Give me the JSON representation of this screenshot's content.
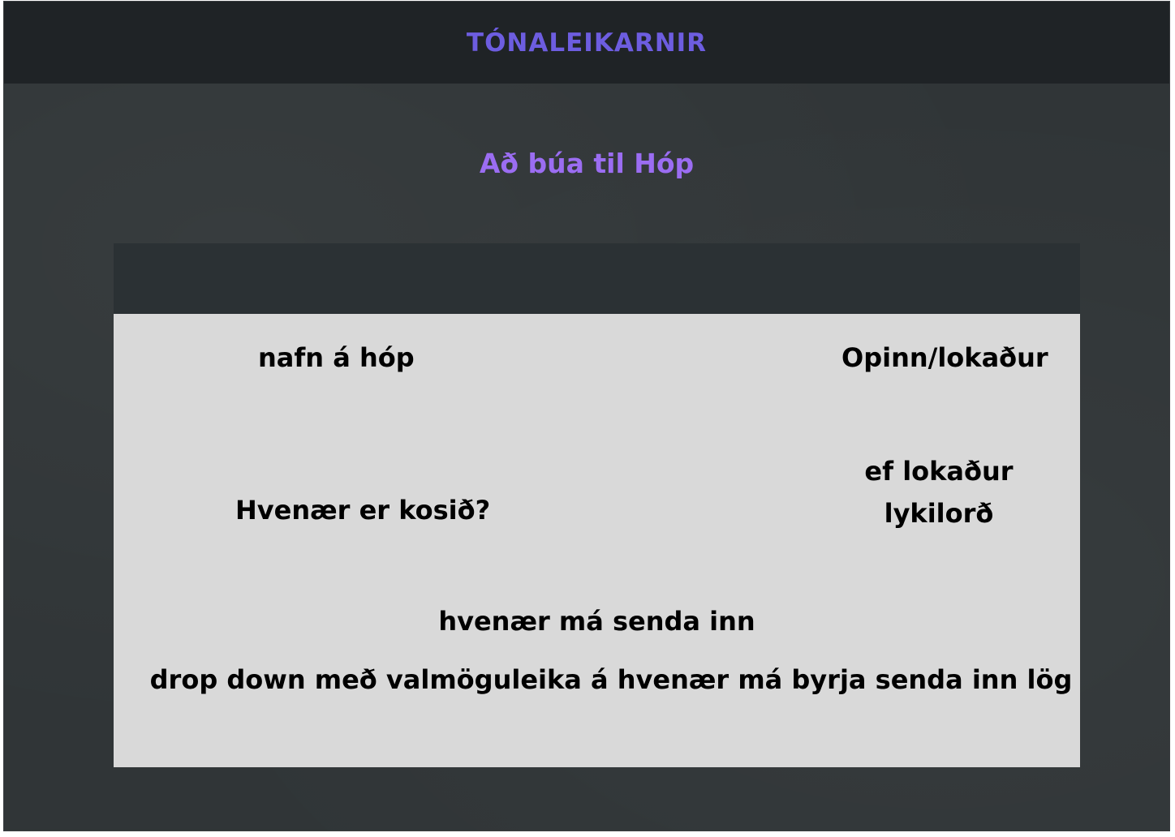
{
  "header": {
    "title": "TÓNALEIKARNIR"
  },
  "page": {
    "title": "Að búa til Hóp"
  },
  "form": {
    "group_name_label": "nafn á hóp",
    "open_closed_label": "Opinn/lokaður",
    "password_label_line1": "ef lokaður",
    "password_label_line2": "lykilorð",
    "vote_when_label": "Hvenær er kosið?",
    "submit_when_label": "hvenær má senda inn",
    "dropdown_description": "drop down með valmöguleika á hvenær má byrja senda inn lög"
  },
  "colors": {
    "header_bg": "#1f2326",
    "page_bg": "#303537",
    "header_title": "#6d5de0",
    "page_title": "#9b6df2",
    "card_top": "#2b3134",
    "card_body": "#d9d9d9"
  }
}
